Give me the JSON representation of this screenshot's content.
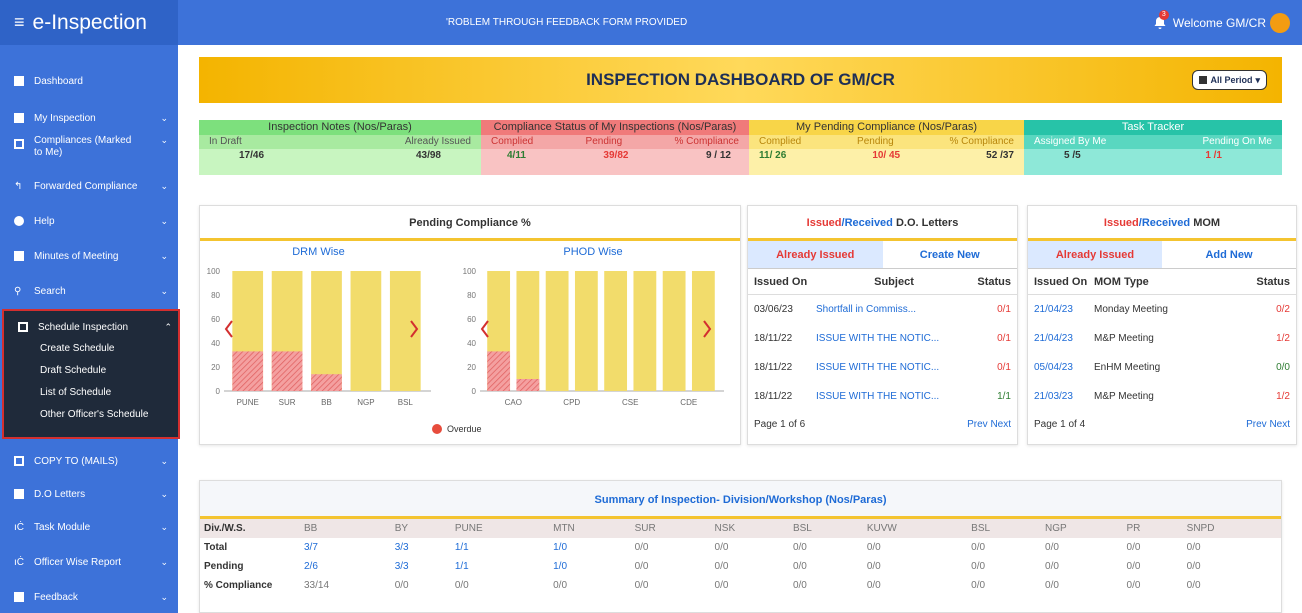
{
  "app": {
    "title": "e-Inspection",
    "marquee": "'ROBLEM THROUGH FEEDBACK FORM PROVIDED",
    "welcome": "Welcome GM/CR",
    "bell_count": "3"
  },
  "sidebar": {
    "items": [
      {
        "label": "Dashboard"
      },
      {
        "label": "My Inspection"
      },
      {
        "label": "Compliances (Marked"
      },
      {
        "label": "to Me)"
      },
      {
        "label": "Forwarded Compliance"
      },
      {
        "label": "Help"
      },
      {
        "label": "Minutes of Meeting"
      },
      {
        "label": "Search"
      },
      {
        "label": "Schedule Inspection"
      },
      {
        "label": "COPY TO (MAILS)"
      },
      {
        "label": "D.O Letters"
      },
      {
        "label": "Task Module"
      },
      {
        "label": "Officer Wise Report"
      },
      {
        "label": "Feedback"
      }
    ],
    "schedule_sub": [
      "Create Schedule",
      "Draft Schedule",
      "List of Schedule",
      "Other Officer's Schedule"
    ]
  },
  "banner": {
    "title": "INSPECTION DASHBOARD OF GM/CR",
    "period": "All Period"
  },
  "cards": [
    {
      "title": "Inspection Notes (Nos/Paras)",
      "sub": [
        "In Draft",
        "Already Issued"
      ],
      "vals": [
        "17/46",
        "43/98"
      ]
    },
    {
      "title": "Compliance Status of My Inspections (Nos/Paras)",
      "sub": [
        "Complied",
        "Pending",
        "% Compliance"
      ],
      "vals": [
        "4/11",
        "39/82",
        "9 / 12"
      ]
    },
    {
      "title": "My Pending Compliance (Nos/Paras)",
      "sub": [
        "Complied",
        "Pending",
        "% Compliance"
      ],
      "vals": [
        "11/ 26",
        "10/ 45",
        "52 /37"
      ]
    },
    {
      "title": "Task Tracker",
      "sub": [
        "Assigned By Me",
        "Pending On Me"
      ],
      "vals": [
        "5 /5",
        "1 /1"
      ]
    }
  ],
  "pending_panel": {
    "title": "Pending Compliance %",
    "drm_title": "DRM Wise",
    "phod_title": "PHOD Wise",
    "legend": "Overdue"
  },
  "chart_data": [
    {
      "type": "bar",
      "title": "DRM Wise",
      "categories": [
        "PUNE",
        "SUR",
        "BB",
        "NGP",
        "BSL"
      ],
      "series": [
        {
          "values": [
            100,
            100,
            100,
            100,
            100
          ]
        },
        {
          "name": "Overdue",
          "values": [
            33,
            33,
            14,
            0,
            0
          ]
        }
      ],
      "ylim": [
        0,
        100
      ],
      "yticks": [
        "0",
        "20",
        "40",
        "60",
        "80",
        "100"
      ]
    },
    {
      "type": "bar",
      "title": "PHOD Wise",
      "categories": [
        "CAO",
        "",
        "CPD",
        "",
        "CSE",
        "",
        "CDE",
        ""
      ],
      "series": [
        {
          "values": [
            100,
            100,
            100,
            100,
            100,
            100,
            100,
            100
          ]
        },
        {
          "name": "Overdue",
          "values": [
            33,
            10,
            0,
            0,
            0,
            0,
            0,
            0
          ]
        }
      ],
      "ylim": [
        0,
        100
      ],
      "yticks": [
        "0",
        "20",
        "40",
        "60",
        "80",
        "100"
      ]
    }
  ],
  "do_panel": {
    "title_issued": "Issued",
    "title_received": "/Received",
    "title_rest": " D.O. Letters",
    "tab_active": "Already Issued",
    "tab_other": "Create New",
    "headers": [
      "Issued On",
      "Subject",
      "Status"
    ],
    "rows": [
      [
        "03/06/23",
        "Shortfall in Commiss...",
        "0/1"
      ],
      [
        "18/11/22",
        "ISSUE WITH THE NOTIC...",
        "0/1"
      ],
      [
        "18/11/22",
        "ISSUE WITH THE NOTIC...",
        "0/1"
      ],
      [
        "18/11/22",
        "ISSUE WITH THE NOTIC...",
        "1/1"
      ]
    ],
    "page": "Page 1 of 6",
    "prev": "Prev",
    "next": "Next"
  },
  "mom_panel": {
    "title_issued": "Issued",
    "title_received": "/Received",
    "title_rest": " MOM",
    "tab_active": "Already Issued",
    "tab_other": "Add New",
    "headers": [
      "Issued On",
      "MOM Type",
      "Status"
    ],
    "rows": [
      [
        "21/04/23",
        "Monday Meeting",
        "0/2"
      ],
      [
        "21/04/23",
        "M&P Meeting",
        "1/2"
      ],
      [
        "05/04/23",
        "EnHM Meeting",
        "0/0"
      ],
      [
        "21/03/23",
        "M&P Meeting",
        "1/2"
      ]
    ],
    "page": "Page 1 of 4",
    "prev": "Prev",
    "next": "Next"
  },
  "summary": {
    "title": "Summary of Inspection- Division/Workshop (Nos/Paras)",
    "header": [
      "Div./W.S.",
      "BB",
      "BY",
      "PUNE",
      "MTN",
      "SUR",
      "NSK",
      "BSL",
      "KUVW",
      "BSL",
      "NGP",
      "PR",
      "SNPD"
    ],
    "rows": [
      [
        "Total",
        "3/7",
        "3/3",
        "1/1",
        "1/0",
        "0/0",
        "0/0",
        "0/0",
        "0/0",
        "0/0",
        "0/0",
        "0/0",
        "0/0"
      ],
      [
        "Pending",
        "2/6",
        "3/3",
        "1/1",
        "1/0",
        "0/0",
        "0/0",
        "0/0",
        "0/0",
        "0/0",
        "0/0",
        "0/0",
        "0/0"
      ],
      [
        "% Compliance",
        "33/14",
        "0/0",
        "0/0",
        "0/0",
        "0/0",
        "0/0",
        "0/0",
        "0/0",
        "0/0",
        "0/0",
        "0/0",
        "0/0"
      ]
    ]
  },
  "colors": {
    "sidebar": "#3d72d9",
    "banner": "#f4b400",
    "bar": "#f2dc6b",
    "overdue": "#f08080"
  }
}
